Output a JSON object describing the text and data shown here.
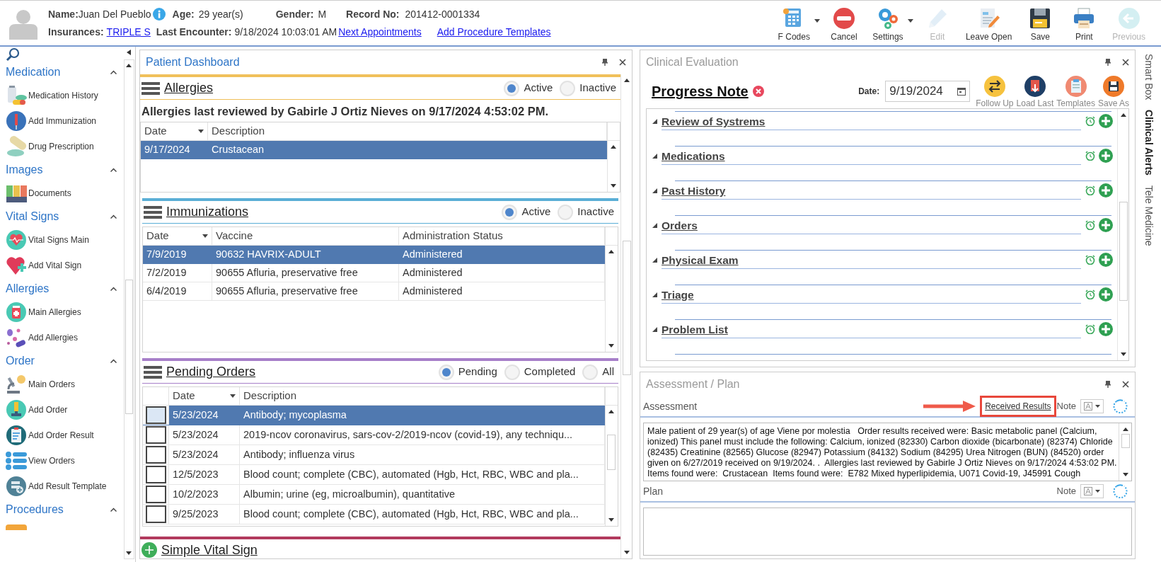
{
  "patient": {
    "name_label": "Name:",
    "name": "Juan Del Pueblo",
    "age_label": "Age:",
    "age": "29 year(s)",
    "gender_label": "Gender:",
    "gender": "M",
    "record_label": "Record No:",
    "record": "201412-0001334",
    "insurances_label": "Insurances:",
    "insurance": "TRIPLE S",
    "last_encounter_label": "Last Encounter:",
    "last_encounter": "9/18/2024 10:03:01 AM",
    "links": [
      "Next Appointments",
      "Add Procedure Templates"
    ]
  },
  "toolbar": [
    {
      "label": "F Codes",
      "dropdown": true,
      "disabled": false
    },
    {
      "label": "Cancel",
      "dropdown": false,
      "disabled": false
    },
    {
      "label": "Settings",
      "dropdown": true,
      "disabled": false
    },
    {
      "label": "Edit",
      "dropdown": false,
      "disabled": true
    },
    {
      "label": "Leave Open",
      "dropdown": false,
      "disabled": false
    },
    {
      "label": "Save",
      "dropdown": false,
      "disabled": false
    },
    {
      "label": "Print",
      "dropdown": false,
      "disabled": false
    },
    {
      "label": "Previous",
      "dropdown": false,
      "disabled": true
    }
  ],
  "sidebar": {
    "groups": [
      {
        "title": "Medication",
        "expanded": true,
        "items": [
          "Medication History",
          "Add Immunization",
          "Drug Prescription"
        ]
      },
      {
        "title": "Images",
        "expanded": true,
        "items": [
          "Documents"
        ]
      },
      {
        "title": "Vital Signs",
        "expanded": true,
        "items": [
          "Vital Signs Main",
          "Add Vital Sign"
        ]
      },
      {
        "title": "Allergies",
        "expanded": true,
        "items": [
          "Main Allergies",
          "Add Allergies"
        ]
      },
      {
        "title": "Order",
        "expanded": true,
        "items": [
          "Main Orders",
          "Add Order",
          "Add Order Result",
          "View Orders",
          "Add Result Template"
        ]
      },
      {
        "title": "Procedures",
        "expanded": true
      }
    ]
  },
  "dashboard": {
    "title": "Patient Dashboard",
    "sections": [
      {
        "title": "Allergies",
        "color": "#f0c05a",
        "filters": [
          {
            "label": "Active",
            "selected": true
          },
          {
            "label": "Inactive",
            "selected": false
          }
        ],
        "note": "Allergies last reviewed by Gabirle J Ortiz Nieves on 9/17/2024 4:53:02 PM.",
        "table": {
          "checkbox_column": false,
          "columns": [
            {
              "label": "Date",
              "sorted": true
            },
            {
              "label": "Description",
              "sorted": false
            }
          ],
          "rows": [
            {
              "cells": [
                "9/17/2024",
                "Crustacean"
              ],
              "selected": true
            }
          ]
        }
      },
      {
        "title": "Immunizations",
        "color": "#5aaed6",
        "filters": [
          {
            "label": "Active",
            "selected": true
          },
          {
            "label": "Inactive",
            "selected": false
          }
        ],
        "table": {
          "checkbox_column": false,
          "columns": [
            {
              "label": "Date",
              "sorted": true
            },
            {
              "label": "Vaccine",
              "sorted": false
            },
            {
              "label": "Administration Status",
              "sorted": false
            }
          ],
          "rows": [
            {
              "cells": [
                "7/9/2019",
                "90632 HAVRIX-ADULT",
                "Administered"
              ],
              "selected": true
            },
            {
              "cells": [
                "7/2/2019",
                "90655 Afluria, preservative free",
                "Administered"
              ],
              "selected": false
            },
            {
              "cells": [
                "6/4/2019",
                "90655 Afluria, preservative free",
                "Administered"
              ],
              "selected": false
            }
          ]
        }
      },
      {
        "title": "Pending Orders",
        "color": "#a77fc9",
        "filters": [
          {
            "label": "Pending",
            "selected": true
          },
          {
            "label": "Completed",
            "selected": false
          },
          {
            "label": "All",
            "selected": false
          }
        ],
        "table": {
          "checkbox_column": true,
          "columns": [
            {
              "label": "Date",
              "sorted": true
            },
            {
              "label": "Description",
              "sorted": false
            }
          ],
          "rows": [
            {
              "cells": [
                "5/23/2024",
                "Antibody; mycoplasma"
              ],
              "selected": true,
              "checked": false
            },
            {
              "cells": [
                "5/23/2024",
                "2019-ncov coronavirus, sars-cov-2/2019-ncov (covid-19), any techniqu..."
              ],
              "selected": false,
              "checked": false
            },
            {
              "cells": [
                "5/23/2024",
                "Antibody; influenza virus"
              ],
              "selected": false,
              "checked": false
            },
            {
              "cells": [
                "12/5/2023",
                "Blood count; complete (CBC), automated (Hgb, Hct, RBC, WBC and pla..."
              ],
              "selected": false,
              "checked": false
            },
            {
              "cells": [
                "10/2/2023",
                "Albumin; urine (eg, microalbumin), quantitative"
              ],
              "selected": false,
              "checked": false
            },
            {
              "cells": [
                "9/25/2023",
                "Blood count; complete (CBC), automated (Hgb, Hct, RBC, WBC and pla..."
              ],
              "selected": false,
              "checked": false
            }
          ]
        }
      }
    ],
    "footer_section": {
      "title": "Simple Vital Sign",
      "color": "#b23a5e"
    }
  },
  "clinical_evaluation": {
    "title": "Clinical Evaluation",
    "note_title": "Progress Note",
    "date_label": "Date:",
    "date": "9/19/2024",
    "actions": [
      "Follow Up",
      "Load Last",
      "Templates",
      "Save As"
    ],
    "sections": [
      {
        "title": "Review of Systrems",
        "expanded": true
      },
      {
        "title": "Medications",
        "expanded": true
      },
      {
        "title": "Past History",
        "expanded": true
      },
      {
        "title": "Orders",
        "expanded": true
      },
      {
        "title": "Physical Exam",
        "expanded": true
      },
      {
        "title": "Triage",
        "expanded": true
      },
      {
        "title": "Problem List",
        "expanded": true
      }
    ]
  },
  "assessment_plan": {
    "title": "Assessment / Plan",
    "blocks": [
      {
        "label": "Assessment",
        "link": "Received Results",
        "annotated": true,
        "note_label": "Note",
        "text": "Male patient of 29 year(s) of age Viene por molestia   Order results received were: Basic metabolic panel (Calcium, ionized) This panel must include the following: Calcium, ionized (82330) Carbon dioxide (bicarbonate) (82374) Chloride (82435) Creatinine (82565) Glucose (82947) Potassium (84132) Sodium (84295) Urea Nitrogen (BUN) (84520) order given on 6/27/2019 received on 9/19/2024. .  Allergies last reviewed by Gabirle J Ortiz Nieves on 9/17/2024 4:53:02 PM.    Items found were:  Crustacean  Items found were:  E782 Mixed hyperlipidemia, U071 Covid-19, J45991 Cough"
      },
      {
        "label": "Plan",
        "note_label": "Note"
      }
    ]
  },
  "side_tabs": [
    {
      "label": "Smart Box",
      "selected": false
    },
    {
      "label": "Clinical Alerts",
      "selected": true
    },
    {
      "label": "Tele Medicine",
      "selected": false
    }
  ]
}
